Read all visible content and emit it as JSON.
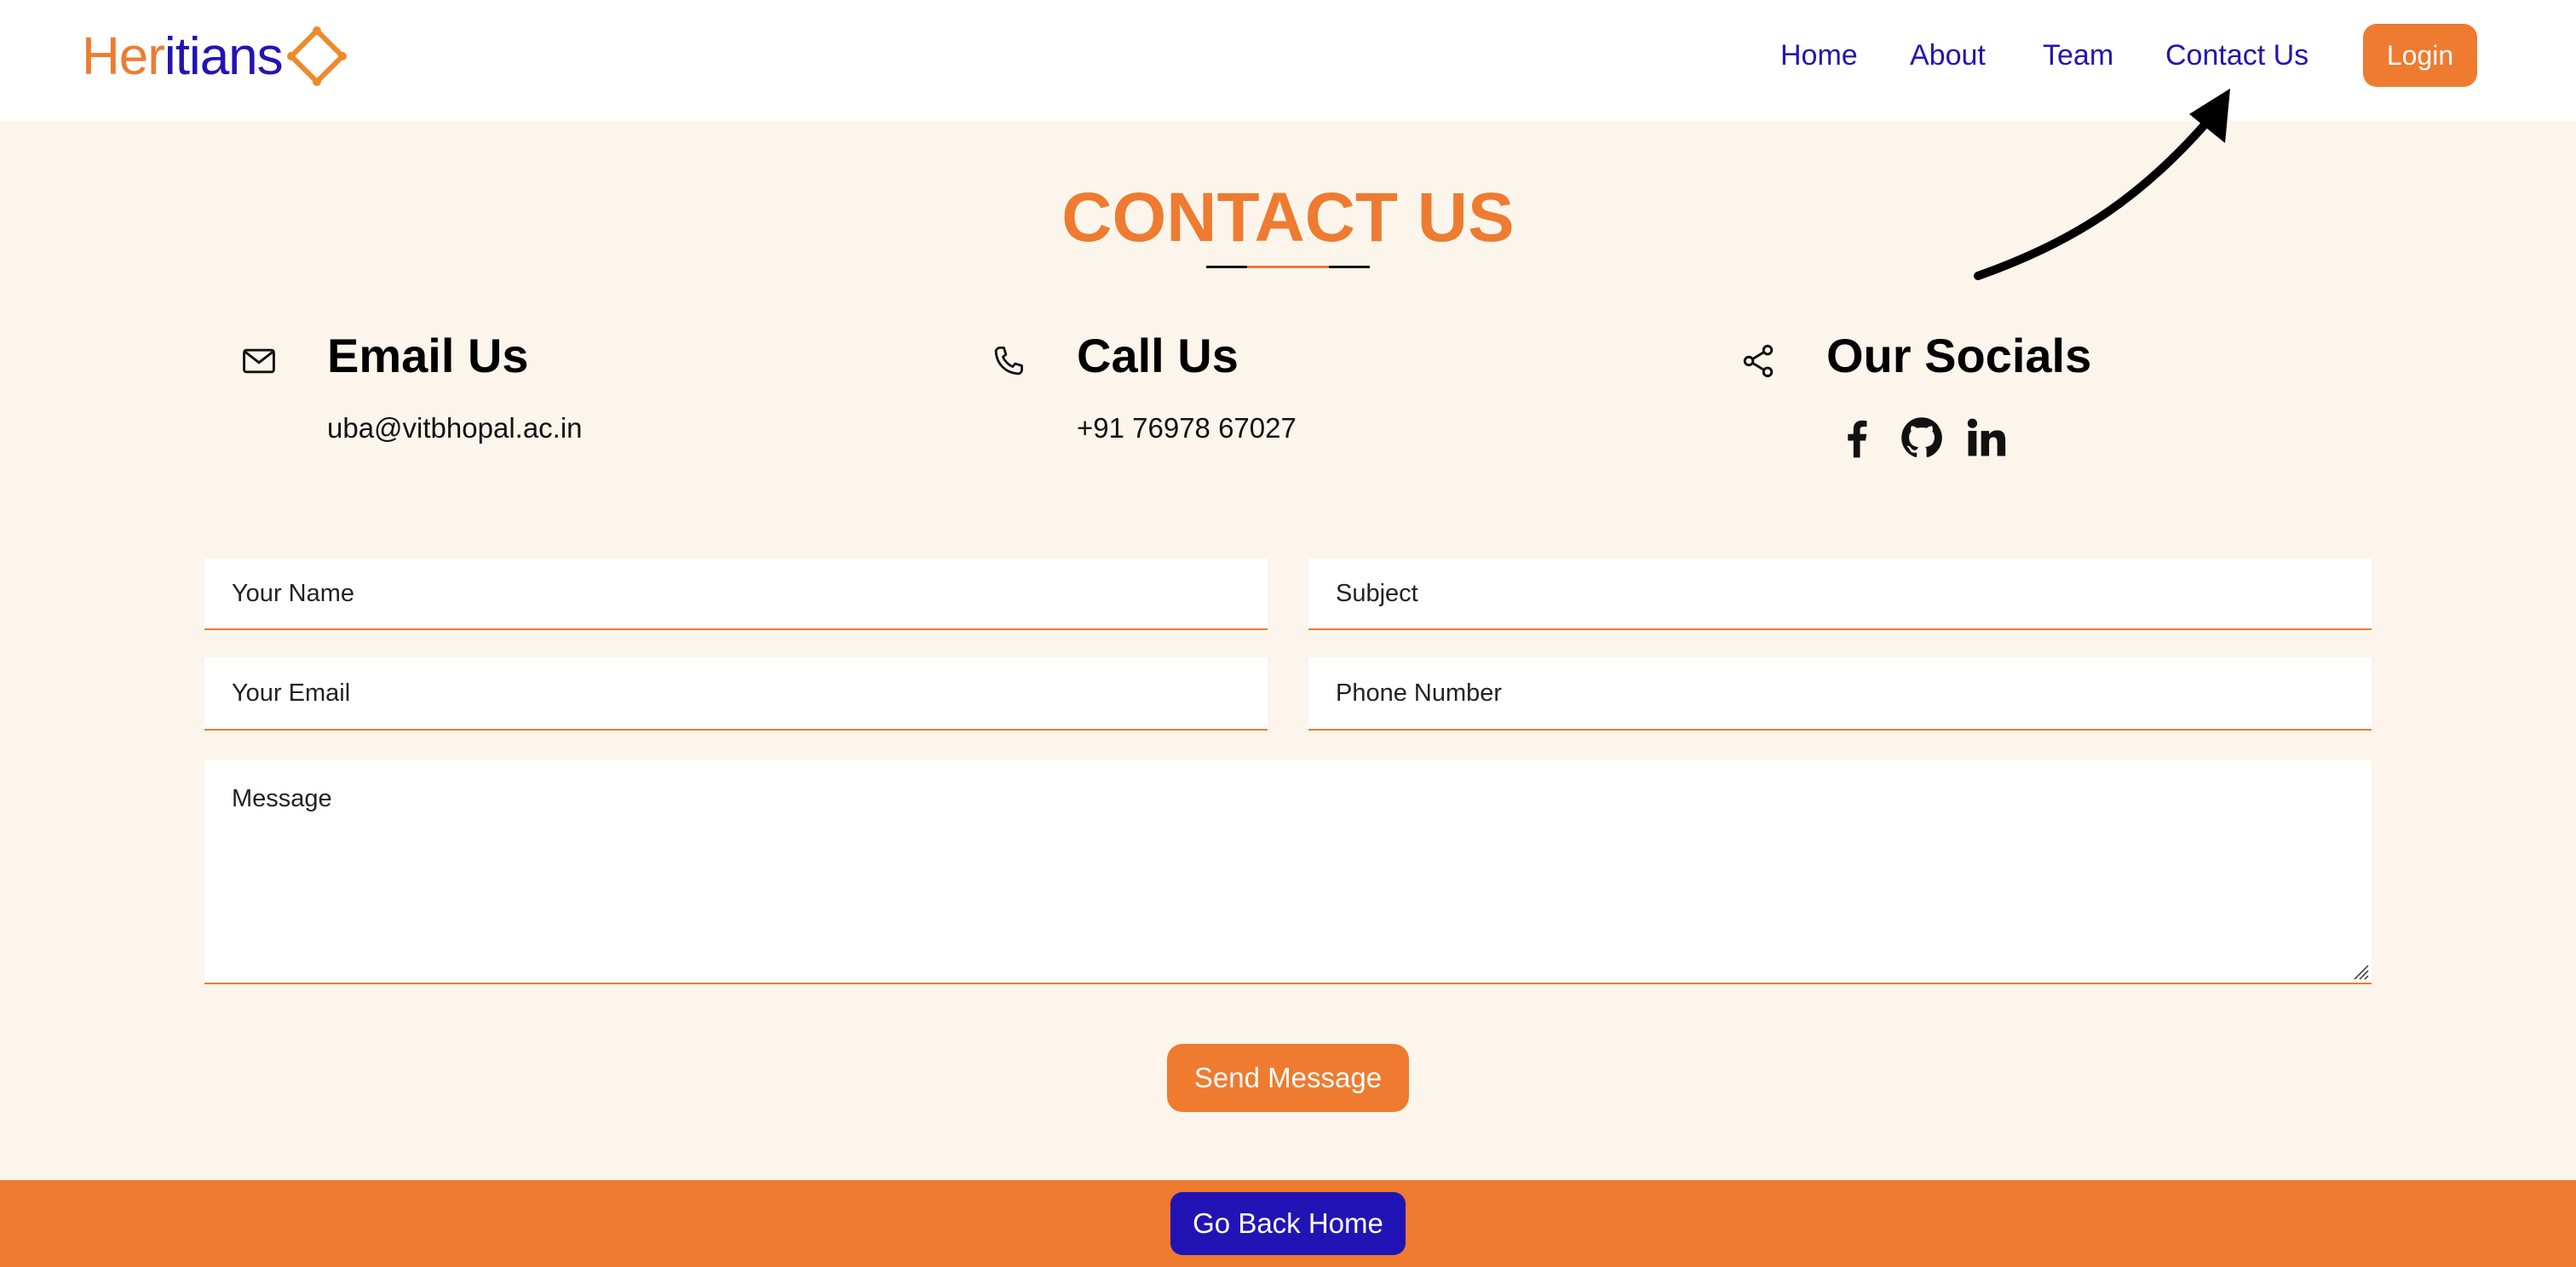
{
  "brand": {
    "logo_part1": "Her",
    "logo_part2": "i",
    "logo_part3": "tians",
    "accent": "#ee7b30",
    "blue": "#2214b4"
  },
  "nav": {
    "links": [
      "Home",
      "About",
      "Team",
      "Contact Us"
    ],
    "login": "Login"
  },
  "page": {
    "title": "CONTACT US"
  },
  "info": {
    "email": {
      "heading": "Email Us",
      "value": "uba@vitbhopal.ac.in",
      "icon": "mail-icon"
    },
    "call": {
      "heading": "Call Us",
      "value": "+91 76978 67027",
      "icon": "phone-icon"
    },
    "socials": {
      "heading": "Our Socials",
      "icon": "share-icon",
      "links": [
        "facebook-icon",
        "github-icon",
        "linkedin-icon"
      ]
    }
  },
  "form": {
    "name_placeholder": "Your Name",
    "subject_placeholder": "Subject",
    "email_placeholder": "Your Email",
    "phone_placeholder": "Phone Number",
    "message_placeholder": "Message",
    "send": "Send Message"
  },
  "footer": {
    "home": "Go Back Home"
  }
}
